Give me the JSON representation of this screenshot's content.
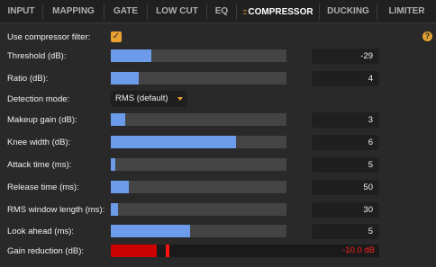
{
  "tabs": [
    {
      "label": "INPUT",
      "active": false
    },
    {
      "label": "MAPPING",
      "active": false
    },
    {
      "label": "GATE",
      "active": false
    },
    {
      "label": "LOW CUT",
      "active": false
    },
    {
      "label": "EQ",
      "active": false
    },
    {
      "label": "COMPRESSOR",
      "active": true,
      "handle": "::"
    },
    {
      "label": "DUCKING",
      "active": false
    },
    {
      "label": "LIMITER",
      "active": false
    }
  ],
  "help_glyph": "?",
  "compressor": {
    "use_filter_label": "Use compressor filter:",
    "use_filter_checked": true,
    "check_glyph": "✓",
    "threshold": {
      "label": "Threshold (dB):",
      "value": "-29",
      "fraction": 0.23
    },
    "ratio": {
      "label": "Ratio (dB):",
      "value": "4",
      "fraction": 0.16
    },
    "detection": {
      "label": "Detection mode:",
      "value": "RMS (default)"
    },
    "makeup_gain": {
      "label": "Makeup gain (dB):",
      "value": "3",
      "fraction": 0.08
    },
    "knee_width": {
      "label": "Knee width (dB):",
      "value": "6",
      "fraction": 0.715
    },
    "attack_time": {
      "label": "Attack time (ms):",
      "value": "5",
      "fraction": 0.025
    },
    "release_time": {
      "label": "Release time (ms):",
      "value": "50",
      "fraction": 0.1
    },
    "rms_window": {
      "label": "RMS window length (ms):",
      "value": "30",
      "fraction": 0.04
    },
    "look_ahead": {
      "label": "Look ahead (ms):",
      "value": "5",
      "fraction": 0.45
    },
    "gain_reduction": {
      "label": "Gain reduction (dB):",
      "value": "-10.0 dB",
      "fraction": 0.17,
      "peak_fraction": 0.205
    }
  },
  "colors": {
    "accent": "#e8a030",
    "slider_fill": "#6c9bea",
    "gain_reduction": "#cc0000"
  }
}
